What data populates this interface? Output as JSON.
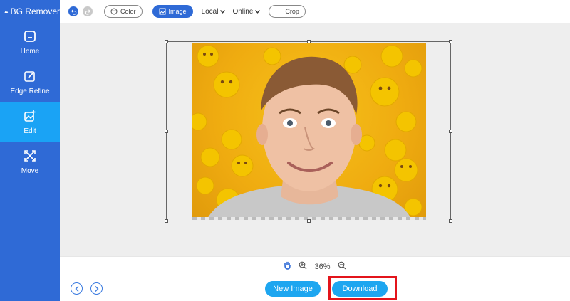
{
  "app": {
    "title": "BG Remover"
  },
  "sidebar": {
    "items": [
      {
        "label": "Home",
        "icon": "home-icon"
      },
      {
        "label": "Edge Refine",
        "icon": "edit-square-icon"
      },
      {
        "label": "Edit",
        "icon": "image-edit-icon",
        "active": true
      },
      {
        "label": "Move",
        "icon": "move-arrows-icon"
      }
    ]
  },
  "toolbar": {
    "color_label": "Color",
    "image_label": "Image",
    "local_label": "Local",
    "online_label": "Online",
    "crop_label": "Crop"
  },
  "zoom": {
    "level": "36%"
  },
  "bottom": {
    "new_image_label": "New Image",
    "download_label": "Download"
  },
  "colors": {
    "sidebar": "#2f6ad6",
    "active": "#1aa3f5",
    "button": "#1da6f0",
    "highlight": "#e3141b"
  }
}
